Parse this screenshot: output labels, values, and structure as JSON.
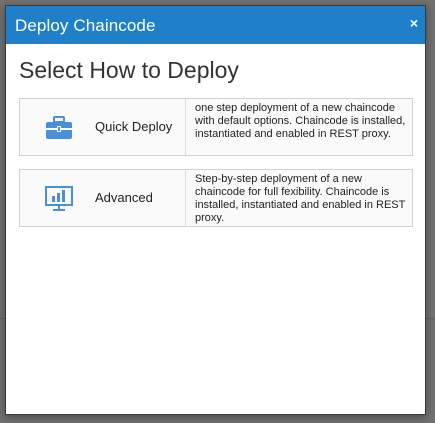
{
  "dialog": {
    "title": "Deploy Chaincode",
    "close_glyph": "×",
    "heading": "Select How to Deploy",
    "header_color": "#1f80c9"
  },
  "options": [
    {
      "label": "Quick Deploy",
      "icon": "briefcase-icon",
      "description": "one step deployment of a new chaincode with default options. Chaincode is installed, instantiated and enabled in REST proxy."
    },
    {
      "label": "Advanced",
      "icon": "monitor-chart-icon",
      "description": "Step-by-step deployment of a new chaincode for full fexibility. Chaincode is installed, instantiated and enabled in REST proxy."
    }
  ]
}
